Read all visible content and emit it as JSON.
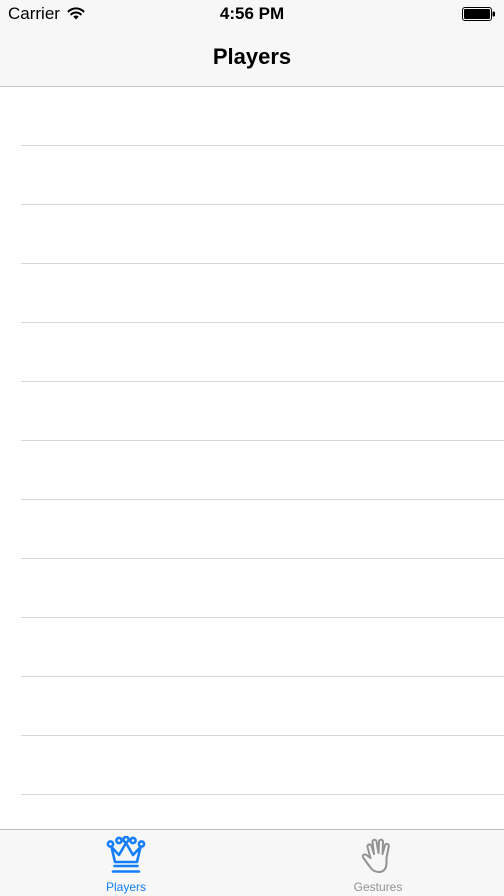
{
  "status_bar": {
    "carrier": "Carrier",
    "time": "4:56 PM",
    "wifi_icon": "wifi-icon",
    "battery_icon": "battery-icon"
  },
  "nav_bar": {
    "title": "Players"
  },
  "table": {
    "rows": [
      "",
      "",
      "",
      "",
      "",
      "",
      "",
      "",
      "",
      "",
      "",
      "",
      ""
    ]
  },
  "tab_bar": {
    "tabs": [
      {
        "label": "Players",
        "icon": "crown-icon",
        "selected": true
      },
      {
        "label": "Gestures",
        "icon": "hand-icon",
        "selected": false
      }
    ]
  },
  "colors": {
    "accent": "#157efb",
    "inactive_tab": "#929292",
    "bar_background": "#f7f7f7",
    "separator": "#d9d9dd"
  }
}
